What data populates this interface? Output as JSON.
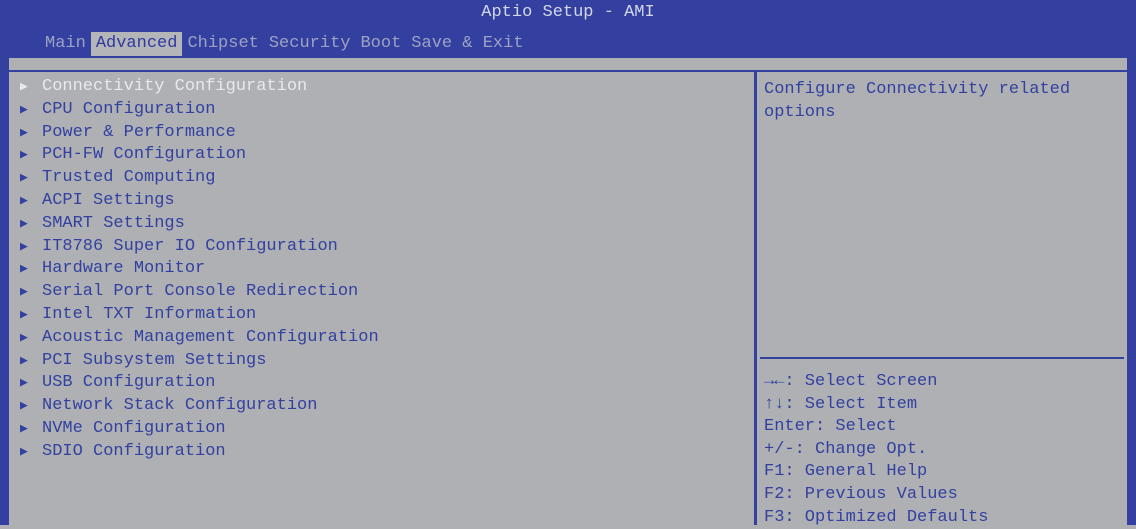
{
  "title": "Aptio Setup - AMI",
  "tabs": [
    "Main",
    "Advanced",
    "Chipset",
    "Security",
    "Boot",
    "Save & Exit"
  ],
  "active_tab": "Advanced",
  "menu": {
    "items": [
      "Connectivity Configuration",
      "CPU Configuration",
      "Power & Performance",
      "PCH-FW Configuration",
      "Trusted Computing",
      "ACPI Settings",
      "SMART Settings",
      "IT8786 Super IO Configuration",
      "Hardware Monitor",
      "Serial Port Console Redirection",
      "Intel TXT Information",
      "Acoustic Management Configuration",
      "PCI Subsystem Settings",
      "USB Configuration",
      "Network Stack Configuration",
      "NVMe Configuration",
      "SDIO Configuration"
    ],
    "selected_item": "Connectivity Configuration"
  },
  "help": {
    "description": "Configure Connectivity related options",
    "keys": [
      "→←: Select Screen",
      "↑↓: Select Item",
      "Enter: Select",
      "+/-: Change Opt.",
      "F1: General Help",
      "F2: Previous Values",
      "F3: Optimized Defaults"
    ]
  },
  "colors": {
    "accent": "#3340a0",
    "background": "#aeb0b4",
    "selected_text": "#e8e9ee"
  },
  "icons": {
    "submenu": "triangle-right-icon"
  }
}
